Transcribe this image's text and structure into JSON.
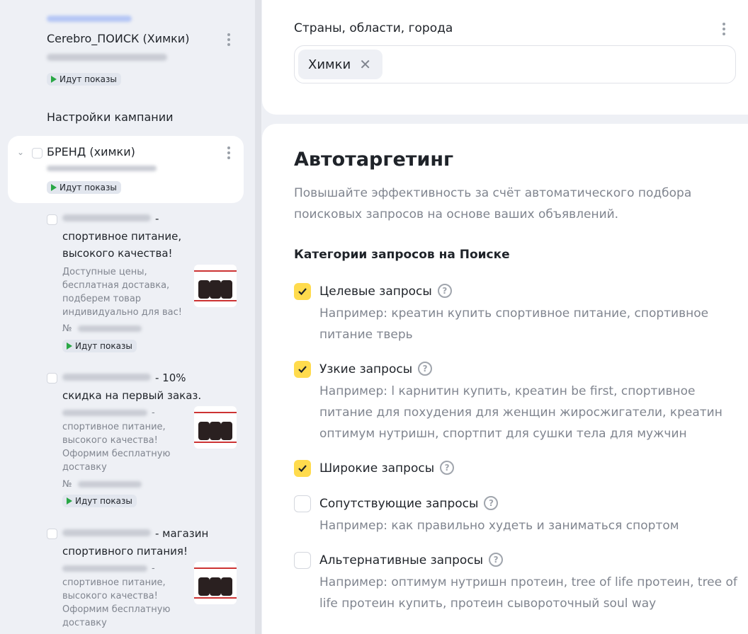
{
  "sidebar": {
    "campaign": {
      "name": "Cerebro_ПОИСК (Химки)",
      "status": "Идут показы"
    },
    "settings_link": "Настройки кампании",
    "group": {
      "name": "БРЕНД (химки)",
      "status": "Идут показы"
    },
    "ads": [
      {
        "title_suffix": "-",
        "title_rest": "спортивное питание, высокого качества!",
        "text": "Доступные цены, бесплатная доставка, подберем товар индивидуально для вас!",
        "number_label": "№",
        "status": "Идут показы"
      },
      {
        "title_suffix": "- 10%",
        "title_rest": "скидка на первый заказ.",
        "text_suffix": "-",
        "text": "спортивное питание, высокого качества! Оформим бесплатную доставку",
        "number_label": "№",
        "status": "Идут показы"
      },
      {
        "title_suffix": "- магазин",
        "title_rest": "спортивного питания!",
        "text_suffix": "-",
        "text": "спортивное питание, высокого качества! Оформим бесплатную доставку"
      }
    ]
  },
  "regions": {
    "label": "Страны, области, города",
    "tags": [
      "Химки"
    ]
  },
  "autotargeting": {
    "title": "Автотаргетинг",
    "description": "Повышайте эффективность за счёт автоматического подбора поисковых запросов на основе ваших объявлений.",
    "categories_title": "Категории запросов на Поиске",
    "options": [
      {
        "label": "Целевые запросы",
        "checked": true,
        "example": "Например: креатин купить спортивное питание, спортивное питание тверь"
      },
      {
        "label": "Узкие запросы",
        "checked": true,
        "example": "Например: l карнитин купить, креатин be first, спортивное питание для похудения для женщин жиросжигатели, креатин оптимум нутришн, спортпит для сушки тела для мужчин"
      },
      {
        "label": "Широкие запросы",
        "checked": true,
        "example": ""
      },
      {
        "label": "Сопутствующие запросы",
        "checked": false,
        "example": "Например: как правильно худеть и заниматься спортом"
      },
      {
        "label": "Альтернативные запросы",
        "checked": false,
        "example": "Например: оптимум нутришн протеин, tree of life протеин, tree of life протеин купить, протеин сывороточный soul way"
      }
    ]
  },
  "colors": {
    "accent": "#ffdb4d",
    "status_green": "#29a745"
  }
}
